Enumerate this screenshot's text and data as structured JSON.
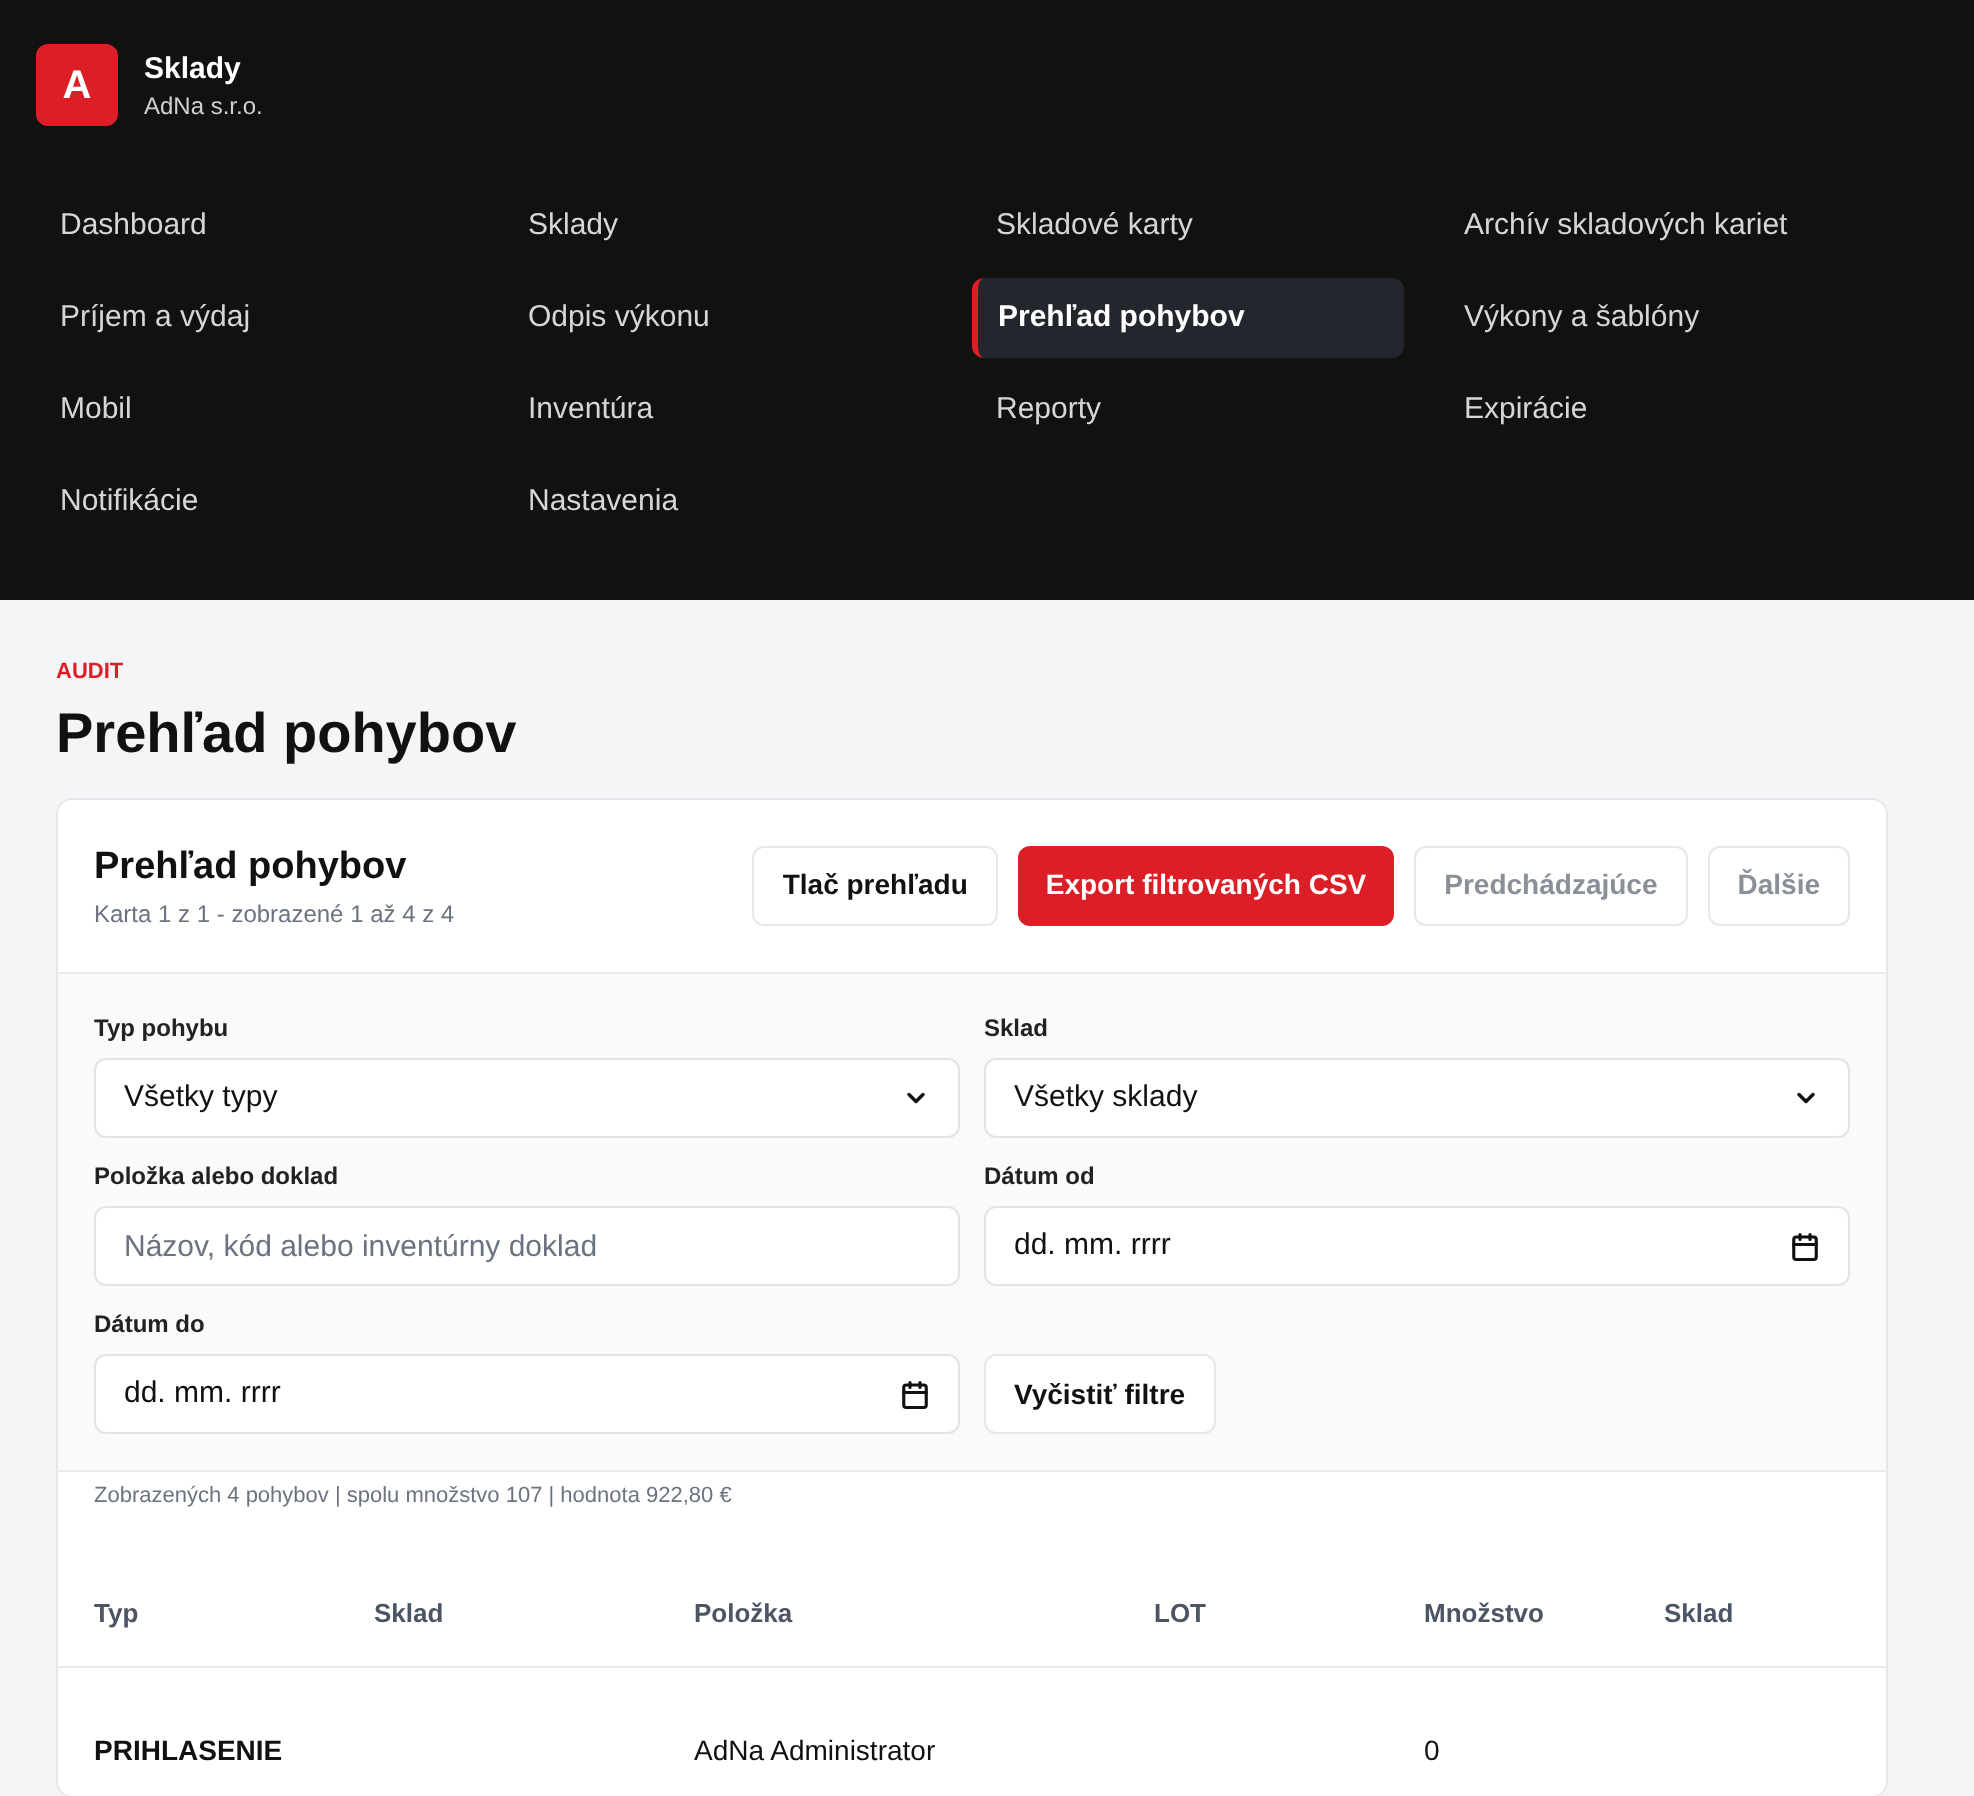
{
  "brand": {
    "logo": "A",
    "title": "Sklady",
    "subtitle": "AdNa s.r.o."
  },
  "nav": [
    {
      "label": "Dashboard",
      "selected": false
    },
    {
      "label": "Sklady",
      "selected": false
    },
    {
      "label": "Skladové karty",
      "selected": false
    },
    {
      "label": "Archív skladových kariet",
      "selected": false
    },
    {
      "label": "Príjem a výdaj",
      "selected": false
    },
    {
      "label": "Odpis výkonu",
      "selected": false
    },
    {
      "label": "Prehľad pohybov",
      "selected": true
    },
    {
      "label": "Výkony a šablóny",
      "selected": false
    },
    {
      "label": "Mobil",
      "selected": false
    },
    {
      "label": "Inventúra",
      "selected": false
    },
    {
      "label": "Reporty",
      "selected": false
    },
    {
      "label": "Expirácie",
      "selected": false
    },
    {
      "label": "Notifikácie",
      "selected": false
    },
    {
      "label": "Nastavenia",
      "selected": false
    }
  ],
  "page": {
    "eyebrow": "AUDIT",
    "title": "Prehľad pohybov"
  },
  "card": {
    "title": "Prehľad pohybov",
    "subtitle": "Karta 1 z 1 - zobrazené 1 až 4 z 4",
    "buttons": [
      {
        "label": "Tlač prehľadu",
        "kind": "secondary",
        "disabled": false
      },
      {
        "label": "Export filtrovaných CSV",
        "kind": "primary",
        "disabled": false
      },
      {
        "label": "Predchádzajúce",
        "kind": "secondary",
        "disabled": true
      },
      {
        "label": "Ďalšie",
        "kind": "secondary",
        "disabled": true
      }
    ]
  },
  "filters": [
    {
      "label": "Typ pohybu",
      "kind": "select",
      "value": "Všetky typy"
    },
    {
      "label": "Sklad",
      "kind": "select",
      "value": "Všetky sklady"
    },
    {
      "label": "Položka alebo doklad",
      "kind": "text",
      "placeholder": "Názov, kód alebo inventúrny doklad"
    },
    {
      "label": "Dátum od",
      "kind": "date",
      "value": "dd. mm. rrrr"
    },
    {
      "label": "Dátum do",
      "kind": "date",
      "value": "dd. mm. rrrr"
    },
    {
      "label": "Vyčistiť filtre",
      "kind": "button"
    }
  ],
  "summary": "Zobrazených 4 pohybov | spolu množstvo 107 | hodnota 922,80 €",
  "table": {
    "columns": [
      "Typ",
      "Sklad",
      "Položka",
      "LOT",
      "Množstvo",
      "Sklad"
    ],
    "rows": [
      [
        "PRIHLASENIE",
        "",
        "AdNa Administrator",
        "",
        "0",
        ""
      ]
    ]
  }
}
